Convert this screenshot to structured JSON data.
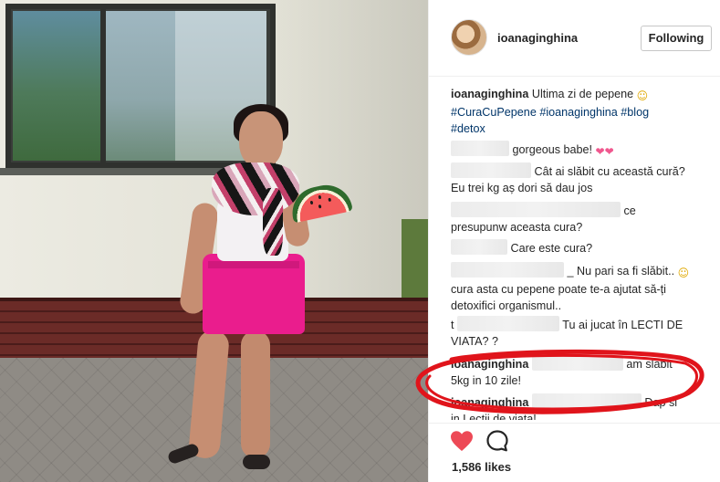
{
  "post": {
    "username": "ioanaginghina",
    "follow_label": "Following",
    "caption": {
      "username": "ioanaginghina",
      "text": "Ultima zi de pepene",
      "hashtag_1": "#CuraCuPepene",
      "hashtag_2": "#ioanaginghina",
      "hashtag_3": "#blog",
      "hashtag_4": "#detox"
    },
    "comments": [
      {
        "text": "gorgeous babe!"
      },
      {
        "text_1": "Cât ai slăbit cu această cură?",
        "text_2": "Eu trei kg aș dori să dau jos"
      },
      {
        "text_1": "ce",
        "text_2": "presupunw aceasta cura?"
      },
      {
        "text": "Care este cura?"
      },
      {
        "prefix": "_ Nu pari sa fi slăbit..",
        "text_2": "cura asta cu pepene poate te-a ajutat să-ți",
        "text_3": "detoxifici organismul.."
      },
      {
        "lead": "t",
        "text_1": "Tu ai jucat în LECTI DE",
        "text_2": "VIATA? ?"
      },
      {
        "username": "ioanaginghina",
        "text_1": "am slabit",
        "text_2": "5kg in 10 zile!"
      },
      {
        "username": "ioanaginghina",
        "text_1": "Dap si",
        "text_2": "in Lectii de viata!"
      }
    ],
    "likes_count": "1,586",
    "likes_label": "likes"
  },
  "icons": {
    "like": "heart-icon",
    "comment": "comment-icon",
    "avatar": "avatar"
  },
  "colors": {
    "heart": "#ed4956",
    "hashtag": "#003569",
    "highlight": "#e0141b"
  }
}
